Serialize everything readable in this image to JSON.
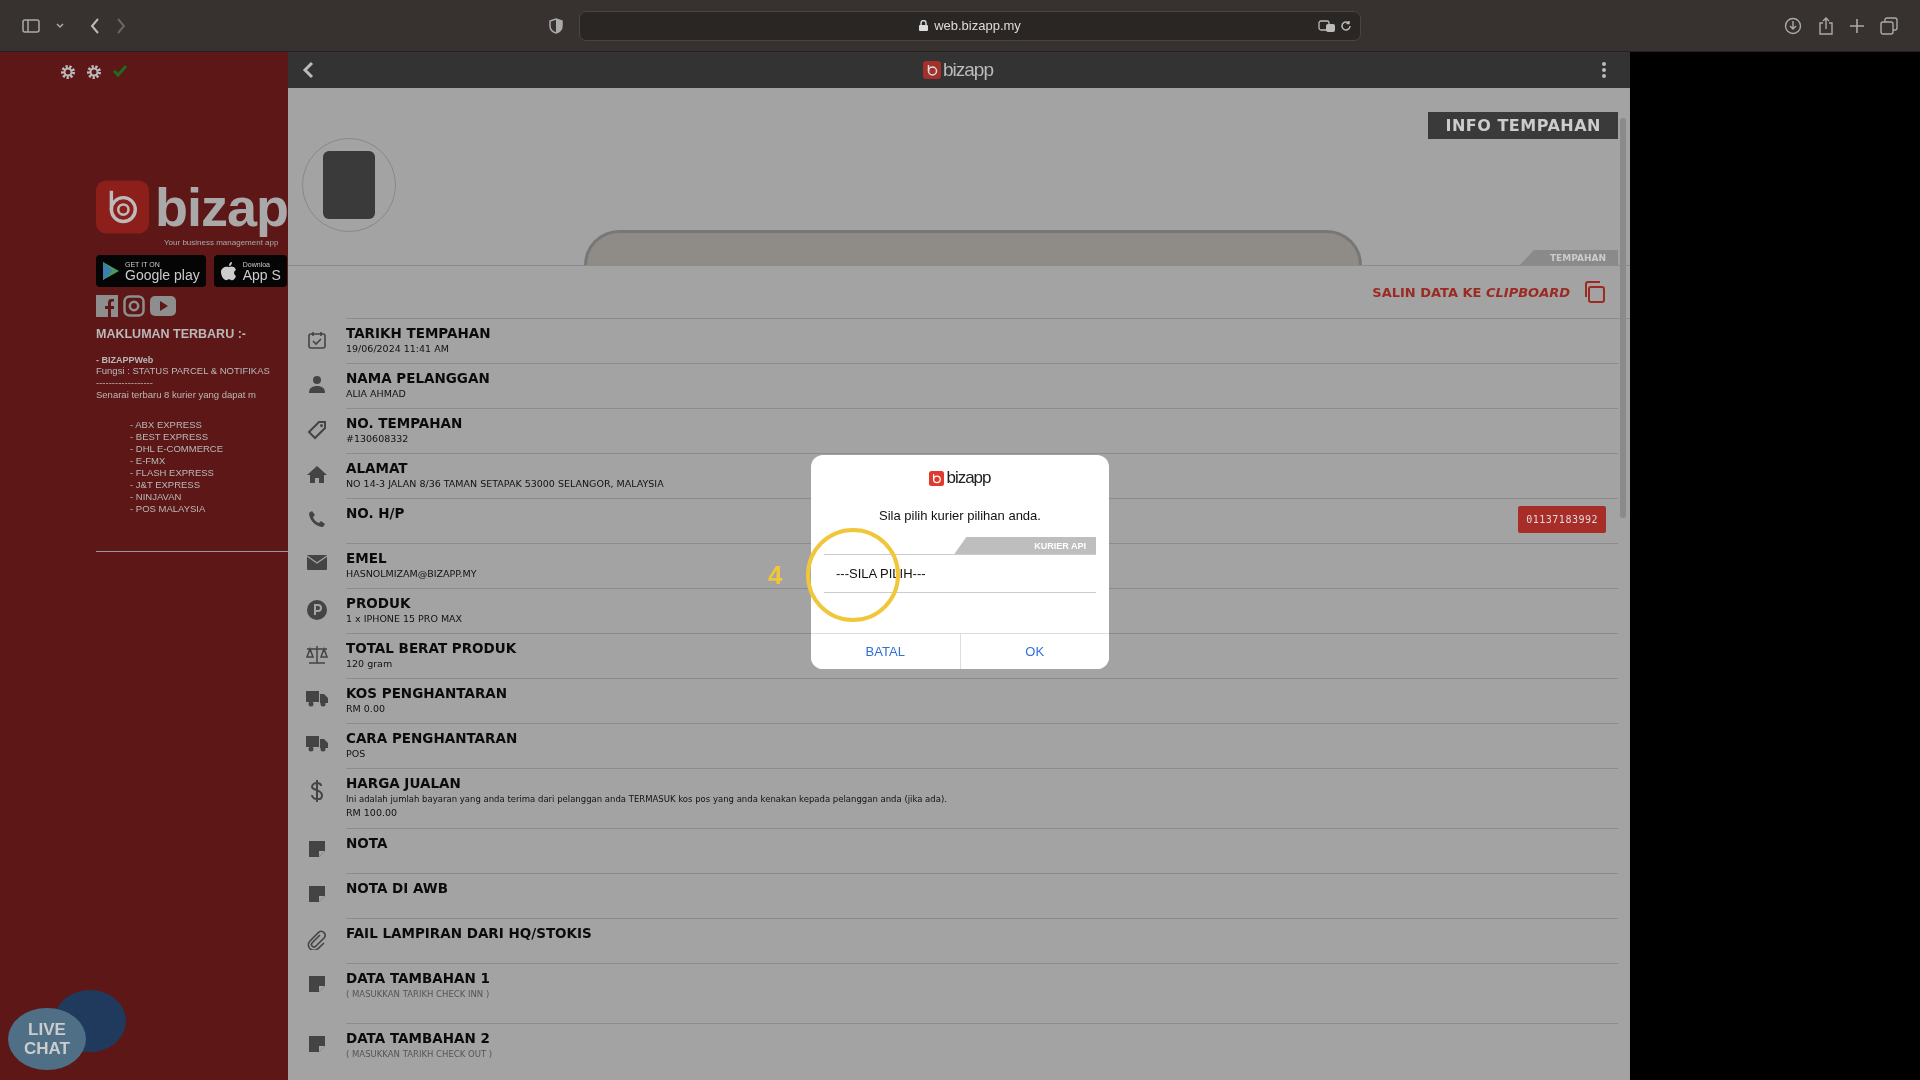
{
  "browser": {
    "url": "web.bizapp.my"
  },
  "sidebar": {
    "logo_text": "bizap",
    "tagline": "Your business management app",
    "store_badges": [
      {
        "small": "GET IT ON",
        "big": "Google play"
      },
      {
        "small": "Downloa",
        "big": "App S"
      }
    ],
    "notice_title": "MAKLUMAN TERBARU :-",
    "notice_heading": "- BIZAPPWeb",
    "notice_lines": [
      "Fungsi : STATUS PARCEL & NOTIFIKAS",
      "------------------",
      "Senarai terbaru 8 kurier yang dapat m"
    ],
    "couriers": [
      "- ABX EXPRESS",
      "- BEST EXPRESS",
      "- DHL E-COMMERCE",
      "- E-FMX",
      "- FLASH EXPRESS",
      "- J&T EXPRESS",
      "- NINJAVAN",
      "- POS MALAYSIA"
    ]
  },
  "live_chat": [
    "LIVE",
    "CHAT"
  ],
  "app_bar": {
    "logo_text": "bizapp"
  },
  "order": {
    "header_badge": "INFO TEMPAHAN",
    "section_tag": "TEMPAHAN",
    "copy_link": "SALIN DATA KE *CLIPBOARD*",
    "fields": [
      {
        "title": "TARIKH TEMPAHAN",
        "value": "19/06/2024 11:41 AM"
      },
      {
        "title": "NAMA PELANGGAN",
        "value": "ALIA AHMAD"
      },
      {
        "title": "NO. TEMPAHAN",
        "value": "#130608332"
      },
      {
        "title": "ALAMAT",
        "value": "NO 14-3 JALAN 8/36 TAMAN SETAPAK 53000 SELANGOR, MALAYSIA"
      },
      {
        "title": "NO. H/P",
        "phone": "01137183992"
      },
      {
        "title": "EMEL",
        "value": "HASNOLMIZAM@BIZAPP.MY"
      },
      {
        "title": "PRODUK",
        "value": "1 x IPHONE 15 PRO MAX"
      },
      {
        "title": "TOTAL BERAT PRODUK",
        "value": "120 gram"
      },
      {
        "title": "KOS PENGHANTARAN",
        "value": "RM 0.00"
      },
      {
        "title": "CARA PENGHANTARAN",
        "value": "POS"
      },
      {
        "title": "HARGA JUALAN",
        "note": "Ini adalah jumlah bayaran yang anda terima dari pelanggan anda TERMASUK kos pos yang anda kenakan kepada pelanggan anda (jika ada).",
        "value": "RM 100.00"
      },
      {
        "title": "NOTA"
      },
      {
        "title": "NOTA DI AWB"
      },
      {
        "title": "FAIL LAMPIRAN DARI HQ/STOKIS"
      },
      {
        "title": "DATA TAMBAHAN 1",
        "hint": "( MASUKKAN TARIKH CHECK INN )"
      },
      {
        "title": "DATA TAMBAHAN 2",
        "hint": "( MASUKKAN TARIKH CHECK OUT )"
      }
    ]
  },
  "dialog": {
    "logo_text": "bizapp",
    "message": "Sila pilih kurier pilihan anda.",
    "tab": "KURIER API",
    "select_value": "---SILA PILIH---",
    "buttons": [
      "BATAL",
      "OK"
    ]
  },
  "annotation": {
    "number": "4"
  }
}
